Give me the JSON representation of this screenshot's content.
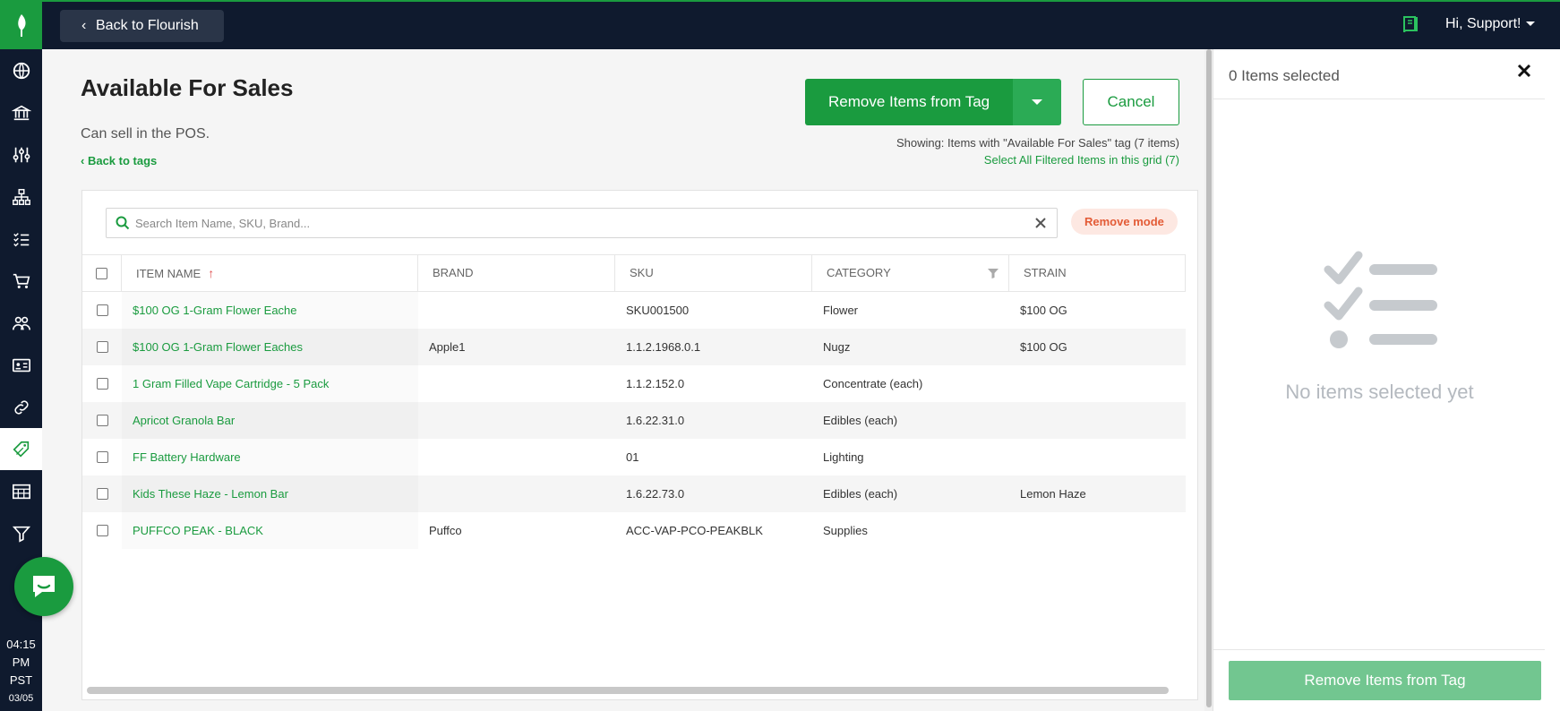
{
  "sidebar": {
    "items": [
      {
        "icon": "globe-icon"
      },
      {
        "icon": "bank-icon"
      },
      {
        "icon": "sliders-icon"
      },
      {
        "icon": "org-chart-icon"
      },
      {
        "icon": "checklist-icon"
      },
      {
        "icon": "cart-icon"
      },
      {
        "icon": "people-icon"
      },
      {
        "icon": "id-card-icon"
      },
      {
        "icon": "link-icon"
      },
      {
        "icon": "tag-icon",
        "active": true
      },
      {
        "icon": "table-icon"
      },
      {
        "icon": "filter-icon"
      }
    ],
    "clock": {
      "time": "04:15",
      "ampm": "PM",
      "tz": "PST",
      "date": "03/05"
    }
  },
  "topbar": {
    "back_label": "Back to Flourish",
    "greeting": "Hi, Support!"
  },
  "page": {
    "title": "Available For Sales",
    "description": "Can sell in the POS.",
    "back_to_tags": "Back to tags",
    "primary_action": "Remove Items from Tag",
    "cancel": "Cancel",
    "showing": "Showing: Items with \"Available For Sales\" tag (7 items)",
    "select_all": "Select All Filtered Items in this grid (7)"
  },
  "search": {
    "placeholder": "Search Item Name, SKU, Brand...",
    "value": ""
  },
  "mode_badge": "Remove mode",
  "table": {
    "columns": [
      "ITEM NAME",
      "BRAND",
      "SKU",
      "CATEGORY",
      "STRAIN"
    ],
    "rows": [
      {
        "name": "$100 OG 1-Gram Flower Eache",
        "brand": "",
        "sku": "SKU001500",
        "category": "Flower",
        "strain": "$100 OG"
      },
      {
        "name": "$100 OG 1-Gram Flower Eaches",
        "brand": "Apple1",
        "sku": "1.1.2.1968.0.1",
        "category": "Nugz",
        "strain": "$100 OG"
      },
      {
        "name": "1 Gram Filled Vape Cartridge - 5 Pack",
        "brand": "",
        "sku": "1.1.2.152.0",
        "category": "Concentrate (each)",
        "strain": ""
      },
      {
        "name": "Apricot Granola Bar",
        "brand": "",
        "sku": "1.6.22.31.0",
        "category": "Edibles (each)",
        "strain": ""
      },
      {
        "name": "FF Battery Hardware",
        "brand": "",
        "sku": "01",
        "category": "Lighting",
        "strain": ""
      },
      {
        "name": "Kids These Haze - Lemon Bar",
        "brand": "",
        "sku": "1.6.22.73.0",
        "category": "Edibles (each)",
        "strain": "Lemon Haze"
      },
      {
        "name": "PUFFCO PEAK - BLACK",
        "brand": "Puffco",
        "sku": "ACC-VAP-PCO-PEAKBLK",
        "category": "Supplies",
        "strain": ""
      }
    ]
  },
  "right_panel": {
    "count_label": "0 Items selected",
    "empty_text": "No items selected yet",
    "footer_button": "Remove Items from Tag"
  },
  "colors": {
    "brand_green": "#1a9b3f",
    "nav_dark": "#0f1a2e",
    "danger_orange": "#e35b36",
    "disabled_green": "#72c690"
  }
}
